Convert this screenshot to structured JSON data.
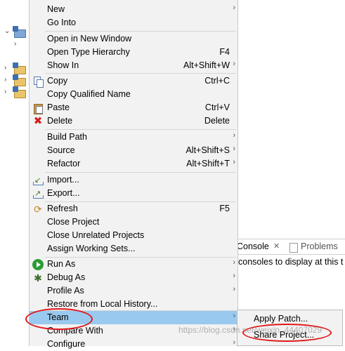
{
  "menu": {
    "items": [
      {
        "label": "New",
        "submenu": true
      },
      {
        "label": "Go Into"
      },
      {
        "label": "Open in New Window"
      },
      {
        "label": "Open Type Hierarchy",
        "shortcut": "F4"
      },
      {
        "label": "Show In",
        "shortcut": "Alt+Shift+W",
        "submenu": true
      },
      {
        "label": "Copy",
        "shortcut": "Ctrl+C",
        "icon": "copy-icon"
      },
      {
        "label": "Copy Qualified Name"
      },
      {
        "label": "Paste",
        "shortcut": "Ctrl+V",
        "icon": "paste-icon"
      },
      {
        "label": "Delete",
        "shortcut": "Delete",
        "icon": "delete-icon"
      },
      {
        "label": "Build Path",
        "submenu": true
      },
      {
        "label": "Source",
        "shortcut": "Alt+Shift+S",
        "submenu": true
      },
      {
        "label": "Refactor",
        "shortcut": "Alt+Shift+T",
        "submenu": true
      },
      {
        "label": "Import...",
        "icon": "import-icon"
      },
      {
        "label": "Export...",
        "icon": "export-icon"
      },
      {
        "label": "Refresh",
        "shortcut": "F5",
        "icon": "refresh-icon"
      },
      {
        "label": "Close Project"
      },
      {
        "label": "Close Unrelated Projects"
      },
      {
        "label": "Assign Working Sets..."
      },
      {
        "label": "Run As",
        "submenu": true,
        "icon": "run-icon"
      },
      {
        "label": "Debug As",
        "submenu": true,
        "icon": "debug-icon"
      },
      {
        "label": "Profile As",
        "submenu": true
      },
      {
        "label": "Restore from Local History..."
      },
      {
        "label": "Team",
        "submenu": true,
        "selected": true
      },
      {
        "label": "Compare With",
        "submenu": true
      },
      {
        "label": "Configure",
        "submenu": true
      }
    ],
    "arrow_glyph": "›"
  },
  "submenu": {
    "items": [
      {
        "label": "Apply Patch..."
      },
      {
        "label": "Share Project..."
      }
    ]
  },
  "console_view": {
    "tab_console": "Console",
    "tab_close": "✕",
    "tab_problems": "Problems",
    "message": "consoles to display at this t"
  },
  "watermark": "https://blog.csdn.net/weixin_44407029",
  "colors": {
    "menu_bg": "#f2f2f2",
    "selection": "#99c9ef",
    "annotation": "#e0191c"
  }
}
